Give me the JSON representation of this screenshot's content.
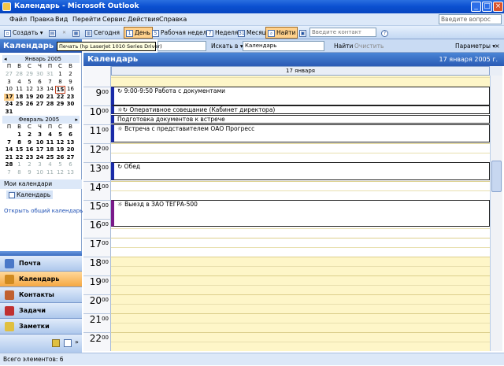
{
  "window": {
    "title": "Календарь - Microsoft Outlook"
  },
  "menu": {
    "items": [
      "Файл",
      "Правка",
      "Вид",
      "Перейти",
      "Сервис",
      "Действия",
      "Справка"
    ],
    "help_placeholder": "Введите вопрос"
  },
  "toolbar": {
    "create_label": "Создать",
    "today_label": "Сегодня",
    "day_label": "День",
    "workweek_label": "Рабочая неделя",
    "week_label": "Неделя",
    "month_label": "Месяц",
    "find_label": "Найти",
    "contact_placeholder": "Введите контакт"
  },
  "tooltip": "Печать (hp LaserJet 1010 Series Driver)",
  "searchbar": {
    "search_in_label": "Искать в",
    "scope_value": "Календарь",
    "find_label": "Найти",
    "clear_label": "Очистить",
    "params_label": "Параметры"
  },
  "nav": {
    "header": "Календарь",
    "jan": {
      "title": "Январь 2005",
      "dow": [
        "П",
        "В",
        "С",
        "Ч",
        "П",
        "С",
        "В"
      ],
      "days": [
        [
          "27",
          "dim"
        ],
        [
          "28",
          "dim"
        ],
        [
          "29",
          "dim"
        ],
        [
          "30",
          "dim"
        ],
        [
          "31",
          "dim"
        ],
        [
          "1",
          ""
        ],
        [
          "2",
          ""
        ],
        [
          "3",
          ""
        ],
        [
          "4",
          ""
        ],
        [
          "5",
          ""
        ],
        [
          "6",
          ""
        ],
        [
          "7",
          ""
        ],
        [
          "8",
          ""
        ],
        [
          "9",
          ""
        ],
        [
          "10",
          ""
        ],
        [
          "11",
          ""
        ],
        [
          "12",
          ""
        ],
        [
          "13",
          ""
        ],
        [
          "14",
          ""
        ],
        [
          "15",
          "today"
        ],
        [
          "16",
          ""
        ],
        [
          "17",
          "sel"
        ],
        [
          "18",
          "bold"
        ],
        [
          "19",
          "bold"
        ],
        [
          "20",
          "bold"
        ],
        [
          "21",
          "bold"
        ],
        [
          "22",
          "bold"
        ],
        [
          "23",
          "bold"
        ],
        [
          "24",
          "bold"
        ],
        [
          "25",
          "bold"
        ],
        [
          "26",
          "bold"
        ],
        [
          "27",
          "bold"
        ],
        [
          "28",
          "bold"
        ],
        [
          "29",
          "bold"
        ],
        [
          "30",
          "bold"
        ],
        [
          "31",
          "bold"
        ],
        [
          "",
          ""
        ],
        [
          "",
          ""
        ],
        [
          "",
          ""
        ],
        [
          "",
          ""
        ],
        [
          "",
          ""
        ],
        [
          "",
          ""
        ]
      ]
    },
    "feb": {
      "title": "Февраль 2005",
      "dow": [
        "П",
        "В",
        "С",
        "Ч",
        "П",
        "С",
        "В"
      ],
      "days": [
        [
          "",
          ""
        ],
        [
          "1",
          "bold"
        ],
        [
          "2",
          "bold"
        ],
        [
          "3",
          "bold"
        ],
        [
          "4",
          "bold"
        ],
        [
          "5",
          "bold"
        ],
        [
          "6",
          "bold"
        ],
        [
          "7",
          "bold"
        ],
        [
          "8",
          "bold"
        ],
        [
          "9",
          "bold"
        ],
        [
          "10",
          "bold"
        ],
        [
          "11",
          "bold"
        ],
        [
          "12",
          "bold"
        ],
        [
          "13",
          "bold"
        ],
        [
          "14",
          "bold"
        ],
        [
          "15",
          "bold"
        ],
        [
          "16",
          "bold"
        ],
        [
          "17",
          "bold"
        ],
        [
          "18",
          "bold"
        ],
        [
          "19",
          "bold"
        ],
        [
          "20",
          "bold"
        ],
        [
          "21",
          "bold"
        ],
        [
          "22",
          "bold"
        ],
        [
          "23",
          "bold"
        ],
        [
          "24",
          "bold"
        ],
        [
          "25",
          "bold"
        ],
        [
          "26",
          "bold"
        ],
        [
          "27",
          "bold"
        ],
        [
          "28",
          "bold"
        ],
        [
          "1",
          "dim"
        ],
        [
          "2",
          "dim"
        ],
        [
          "3",
          "dim"
        ],
        [
          "4",
          "dim"
        ],
        [
          "5",
          "dim"
        ],
        [
          "6",
          "dim"
        ],
        [
          "7",
          "dim"
        ],
        [
          "8",
          "dim"
        ],
        [
          "9",
          "dim"
        ],
        [
          "10",
          "dim"
        ],
        [
          "11",
          "dim"
        ],
        [
          "12",
          "dim"
        ],
        [
          "13",
          "dim"
        ]
      ]
    },
    "my_calendars": "Мои календари",
    "calendar_item": "Календарь",
    "open_shared": "Открыть общий календарь...",
    "buttons": [
      {
        "label": "Почта",
        "icon": "mail-icon",
        "color": "#4a78c8"
      },
      {
        "label": "Календарь",
        "icon": "calendar-icon",
        "color": "#d08a20"
      },
      {
        "label": "Контакты",
        "icon": "contacts-icon",
        "color": "#c06030"
      },
      {
        "label": "Задачи",
        "icon": "tasks-icon",
        "color": "#c03030"
      },
      {
        "label": "Заметки",
        "icon": "notes-icon",
        "color": "#e0c040"
      }
    ]
  },
  "calendar": {
    "title": "Календарь",
    "header_date": "17 января 2005 г.",
    "day_header": "17 января",
    "hours": [
      [
        "9",
        "00"
      ],
      [
        "10",
        "00"
      ],
      [
        "11",
        "00"
      ],
      [
        "12",
        "00"
      ],
      [
        "13",
        "00"
      ],
      [
        "14",
        "00"
      ],
      [
        "15",
        "00"
      ],
      [
        "16",
        "00"
      ],
      [
        "17",
        "00"
      ],
      [
        "18",
        "00"
      ],
      [
        "19",
        "00"
      ],
      [
        "20",
        "00"
      ],
      [
        "21",
        "00"
      ],
      [
        "22",
        "00"
      ]
    ],
    "appointments": [
      {
        "text": "9:00-9:50 Работа с документами",
        "icon": "recurring-icon"
      },
      {
        "text": "Оперативное совещание (Кабинет директора)",
        "icon": "reminder-recurring-icon"
      },
      {
        "text": "Подготовка документов к встрече",
        "icon": ""
      },
      {
        "text": "Встреча с представителем ОАО Прогресс",
        "icon": "reminder-icon"
      },
      {
        "text": "Обед",
        "icon": "recurring-icon"
      },
      {
        "text": "Выезд в ЗАО ТЕГРА-500",
        "icon": "reminder-icon"
      }
    ]
  },
  "status": {
    "text": "Всего элементов: 6"
  }
}
